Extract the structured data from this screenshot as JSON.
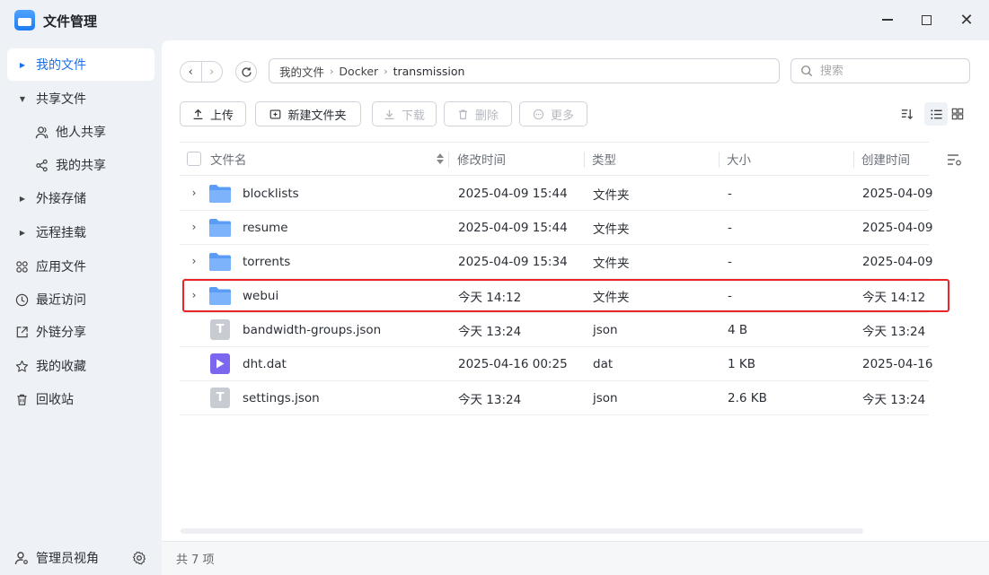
{
  "app": {
    "title": "文件管理"
  },
  "window": {
    "close_glyph": "✕"
  },
  "sidebar": {
    "items": [
      {
        "label": "我的文件",
        "icon": "caret-right-icon",
        "active": true
      },
      {
        "label": "共享文件",
        "icon": "caret-down-icon"
      },
      {
        "label": "他人共享",
        "icon": "person-icon"
      },
      {
        "label": "我的共享",
        "icon": "share-icon"
      },
      {
        "label": "外接存储",
        "icon": "caret-right-icon"
      },
      {
        "label": "远程挂载",
        "icon": "caret-right-icon"
      },
      {
        "label": "应用文件",
        "icon": "apps-icon"
      },
      {
        "label": "最近访问",
        "icon": "clock-icon"
      },
      {
        "label": "外链分享",
        "icon": "external-link-icon"
      },
      {
        "label": "我的收藏",
        "icon": "star-icon"
      },
      {
        "label": "回收站",
        "icon": "trash-icon"
      }
    ],
    "footer": {
      "label": "管理员视角"
    }
  },
  "breadcrumb": [
    "我的文件",
    "Docker",
    "transmission"
  ],
  "search": {
    "placeholder": "搜索"
  },
  "toolbar": {
    "upload": "上传",
    "new_folder": "新建文件夹",
    "download": "下载",
    "delete": "删除",
    "more": "更多"
  },
  "table": {
    "columns": [
      "文件名",
      "修改时间",
      "类型",
      "大小",
      "创建时间"
    ],
    "rows": [
      {
        "name": "blocklists",
        "modified": "2025-04-09 15:44",
        "type": "文件夹",
        "size": "-",
        "created": "2025-04-09",
        "kind": "folder"
      },
      {
        "name": "resume",
        "modified": "2025-04-09 15:44",
        "type": "文件夹",
        "size": "-",
        "created": "2025-04-09",
        "kind": "folder"
      },
      {
        "name": "torrents",
        "modified": "2025-04-09 15:34",
        "type": "文件夹",
        "size": "-",
        "created": "2025-04-09",
        "kind": "folder"
      },
      {
        "name": "webui",
        "modified": "今天 14:12",
        "type": "文件夹",
        "size": "-",
        "created": "今天 14:12",
        "kind": "folder",
        "highlighted": true
      },
      {
        "name": "bandwidth-groups.json",
        "modified": "今天 13:24",
        "type": "json",
        "size": "4 B",
        "created": "今天 13:24",
        "kind": "json"
      },
      {
        "name": "dht.dat",
        "modified": "2025-04-16 00:25",
        "type": "dat",
        "size": "1 KB",
        "created": "2025-04-16",
        "kind": "dat"
      },
      {
        "name": "settings.json",
        "modified": "今天 13:24",
        "type": "json",
        "size": "2.6 KB",
        "created": "今天 13:24",
        "kind": "json"
      }
    ]
  },
  "status": {
    "count": "共 7 项"
  },
  "colors": {
    "accent": "#1e6fe8",
    "folder": "#5b9cf6",
    "highlight": "#e8262a",
    "dat_icon": "#7b66f0"
  }
}
